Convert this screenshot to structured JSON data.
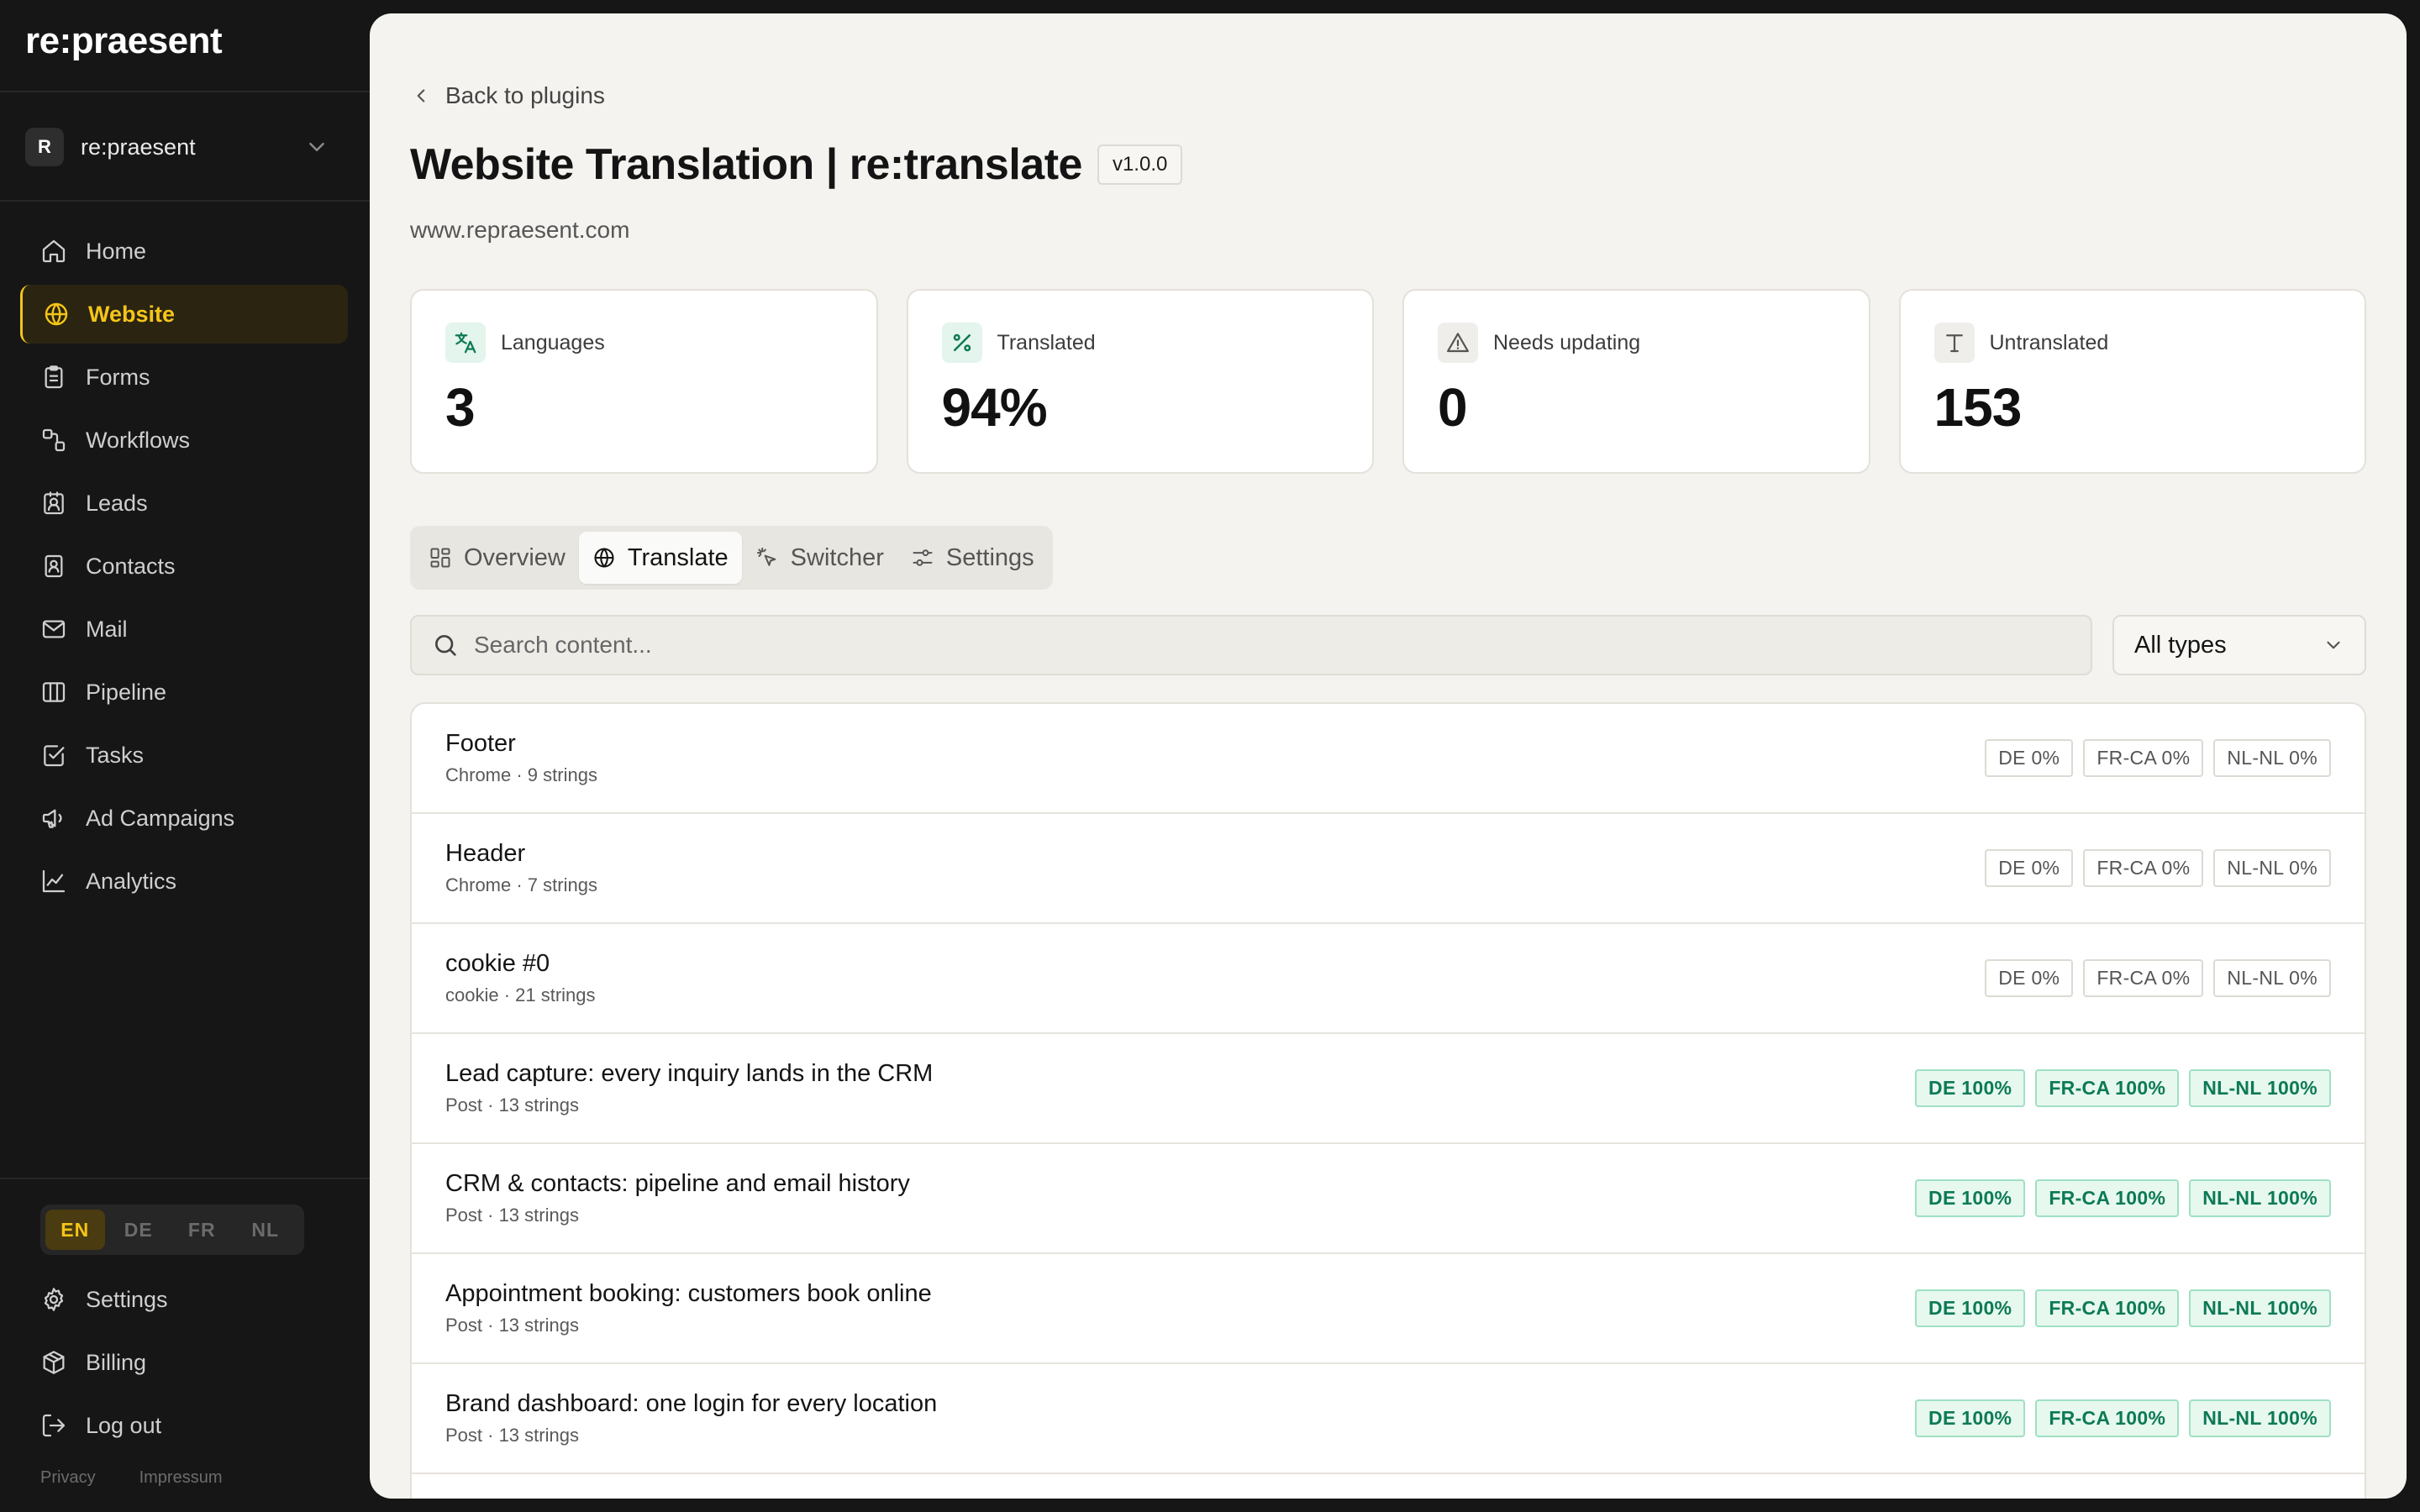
{
  "sidebar": {
    "logo": "re:praesent",
    "workspace": {
      "initial": "R",
      "name": "re:praesent"
    },
    "nav": [
      {
        "label": "Home",
        "icon": "home-icon",
        "active": false
      },
      {
        "label": "Website",
        "icon": "globe-icon",
        "active": true
      },
      {
        "label": "Forms",
        "icon": "clipboard-icon",
        "active": false
      },
      {
        "label": "Workflows",
        "icon": "workflow-icon",
        "active": false
      },
      {
        "label": "Leads",
        "icon": "lead-icon",
        "active": false
      },
      {
        "label": "Contacts",
        "icon": "contact-icon",
        "active": false
      },
      {
        "label": "Mail",
        "icon": "mail-icon",
        "active": false
      },
      {
        "label": "Pipeline",
        "icon": "pipeline-icon",
        "active": false
      },
      {
        "label": "Tasks",
        "icon": "task-icon",
        "active": false
      },
      {
        "label": "Ad Campaigns",
        "icon": "megaphone-icon",
        "active": false
      },
      {
        "label": "Analytics",
        "icon": "chart-icon",
        "active": false
      }
    ],
    "languages": [
      "EN",
      "DE",
      "FR",
      "NL"
    ],
    "active_language": "EN",
    "bottom_nav": [
      {
        "label": "Settings",
        "icon": "gear-icon"
      },
      {
        "label": "Billing",
        "icon": "box-icon"
      },
      {
        "label": "Log out",
        "icon": "logout-icon"
      }
    ],
    "footer": {
      "privacy": "Privacy",
      "impressum": "Impressum"
    }
  },
  "main": {
    "back_label": "Back to plugins",
    "title": "Website Translation | re:translate",
    "version": "v1.0.0",
    "domain": "www.repraesent.com",
    "stats": [
      {
        "label": "Languages",
        "value": "3",
        "icon": "translate-icon",
        "icon_bg": "#e3f5ec",
        "icon_color": "#0d7a56"
      },
      {
        "label": "Translated",
        "value": "94%",
        "icon": "percent-icon",
        "icon_bg": "#e3f5ec",
        "icon_color": "#0d7a56"
      },
      {
        "label": "Needs updating",
        "value": "0",
        "icon": "warning-icon",
        "icon_bg": "#efeeea",
        "icon_color": "#555555"
      },
      {
        "label": "Untranslated",
        "value": "153",
        "icon": "text-icon",
        "icon_bg": "#efeeea",
        "icon_color": "#555555"
      }
    ],
    "tabs": [
      {
        "label": "Overview",
        "icon": "grid-icon",
        "active": false
      },
      {
        "label": "Translate",
        "icon": "globe-icon",
        "active": true
      },
      {
        "label": "Switcher",
        "icon": "pointer-icon",
        "active": false
      },
      {
        "label": "Settings",
        "icon": "sliders-icon",
        "active": false
      }
    ],
    "search": {
      "placeholder": "Search content...",
      "value": ""
    },
    "type_filter": {
      "selected": "All types"
    },
    "items": [
      {
        "title": "Footer",
        "subtitle": "Chrome · 9 strings",
        "badges": [
          {
            "label": "DE 0%",
            "done": false
          },
          {
            "label": "FR-CA 0%",
            "done": false
          },
          {
            "label": "NL-NL 0%",
            "done": false
          }
        ]
      },
      {
        "title": "Header",
        "subtitle": "Chrome · 7 strings",
        "badges": [
          {
            "label": "DE 0%",
            "done": false
          },
          {
            "label": "FR-CA 0%",
            "done": false
          },
          {
            "label": "NL-NL 0%",
            "done": false
          }
        ]
      },
      {
        "title": "cookie #0",
        "subtitle": "cookie · 21 strings",
        "badges": [
          {
            "label": "DE 0%",
            "done": false
          },
          {
            "label": "FR-CA 0%",
            "done": false
          },
          {
            "label": "NL-NL 0%",
            "done": false
          }
        ]
      },
      {
        "title": "Lead capture: every inquiry lands in the CRM",
        "subtitle": "Post · 13 strings",
        "badges": [
          {
            "label": "DE 100%",
            "done": true
          },
          {
            "label": "FR-CA 100%",
            "done": true
          },
          {
            "label": "NL-NL 100%",
            "done": true
          }
        ]
      },
      {
        "title": "CRM & contacts: pipeline and email history",
        "subtitle": "Post · 13 strings",
        "badges": [
          {
            "label": "DE 100%",
            "done": true
          },
          {
            "label": "FR-CA 100%",
            "done": true
          },
          {
            "label": "NL-NL 100%",
            "done": true
          }
        ]
      },
      {
        "title": "Appointment booking: customers book online",
        "subtitle": "Post · 13 strings",
        "badges": [
          {
            "label": "DE 100%",
            "done": true
          },
          {
            "label": "FR-CA 100%",
            "done": true
          },
          {
            "label": "NL-NL 100%",
            "done": true
          }
        ]
      },
      {
        "title": "Brand dashboard: one login for every location",
        "subtitle": "Post · 13 strings",
        "badges": [
          {
            "label": "DE 100%",
            "done": true
          },
          {
            "label": "FR-CA 100%",
            "done": true
          },
          {
            "label": "NL-NL 100%",
            "done": true
          }
        ]
      },
      {
        "title": "",
        "subtitle": "",
        "badges": []
      }
    ]
  }
}
